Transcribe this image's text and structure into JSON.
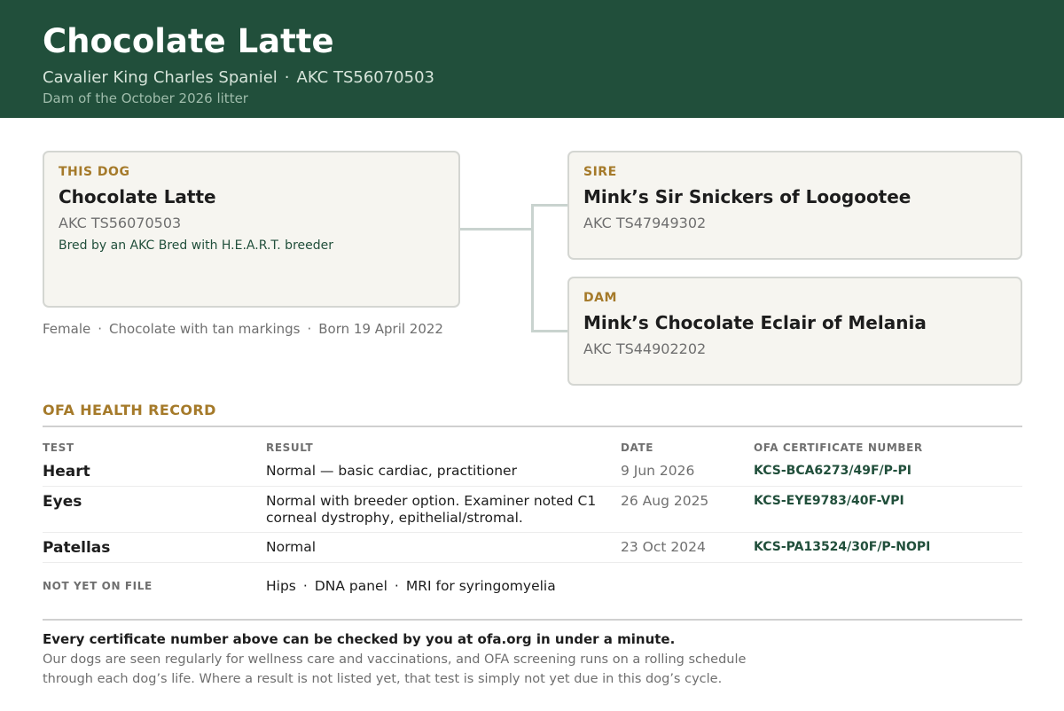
{
  "header": {
    "title": "Chocolate Latte",
    "breed": "Cavalier King Charles Spaniel",
    "separator": "·",
    "registration": "AKC TS56070503",
    "note": "Dam of the October 2026 litter"
  },
  "pedigree": {
    "self": {
      "kicker": "THIS DOG",
      "name": "Chocolate Latte",
      "registration": "AKC TS56070503",
      "note": "Bred by an AKC Bred with H.E.A.R.T. breeder"
    },
    "sire": {
      "kicker": "SIRE",
      "name": "Mink’s Sir Snickers of Loogootee",
      "registration": "AKC TS47949302"
    },
    "dam": {
      "kicker": "DAM",
      "name": "Mink’s Chocolate Eclair of Melania",
      "registration": "AKC TS44902202"
    }
  },
  "traits": {
    "sex": "Female",
    "color": "Chocolate with tan markings",
    "born": "Born 19 April 2022",
    "separator": "·"
  },
  "health": {
    "title": "OFA HEALTH RECORD",
    "columns": {
      "test": "TEST",
      "result": "RESULT",
      "date": "DATE",
      "cert": "OFA CERTIFICATE NUMBER"
    },
    "rows": [
      {
        "test": "Heart",
        "result": "Normal — basic cardiac, practitioner",
        "date": "9 Jun 2026",
        "cert": "KCS-BCA6273/49F/P-PI"
      },
      {
        "test": "Eyes",
        "result": "Normal with breeder option. Examiner noted C1 corneal dystrophy, epithelial/stromal.",
        "date": "26 Aug 2025",
        "cert": "KCS-EYE9783/40F-VPI"
      },
      {
        "test": "Patellas",
        "result": "Normal",
        "date": "23 Oct 2024",
        "cert": "KCS-PA13524/30F/P-NOPI"
      }
    ],
    "pending_label": "NOT YET ON FILE",
    "pending": [
      "Hips",
      "DNA panel",
      "MRI for syringomyelia"
    ],
    "separator": "·"
  },
  "footer": {
    "bold": "Every certificate number above can be checked by you at ofa.org in under a minute.",
    "text": "Our dogs are seen regularly for wellness care and vaccinations, and OFA screening runs on a rolling schedule through each dog’s life. Where a result is not listed yet, that test is simply not yet due in this dog’s cycle."
  }
}
